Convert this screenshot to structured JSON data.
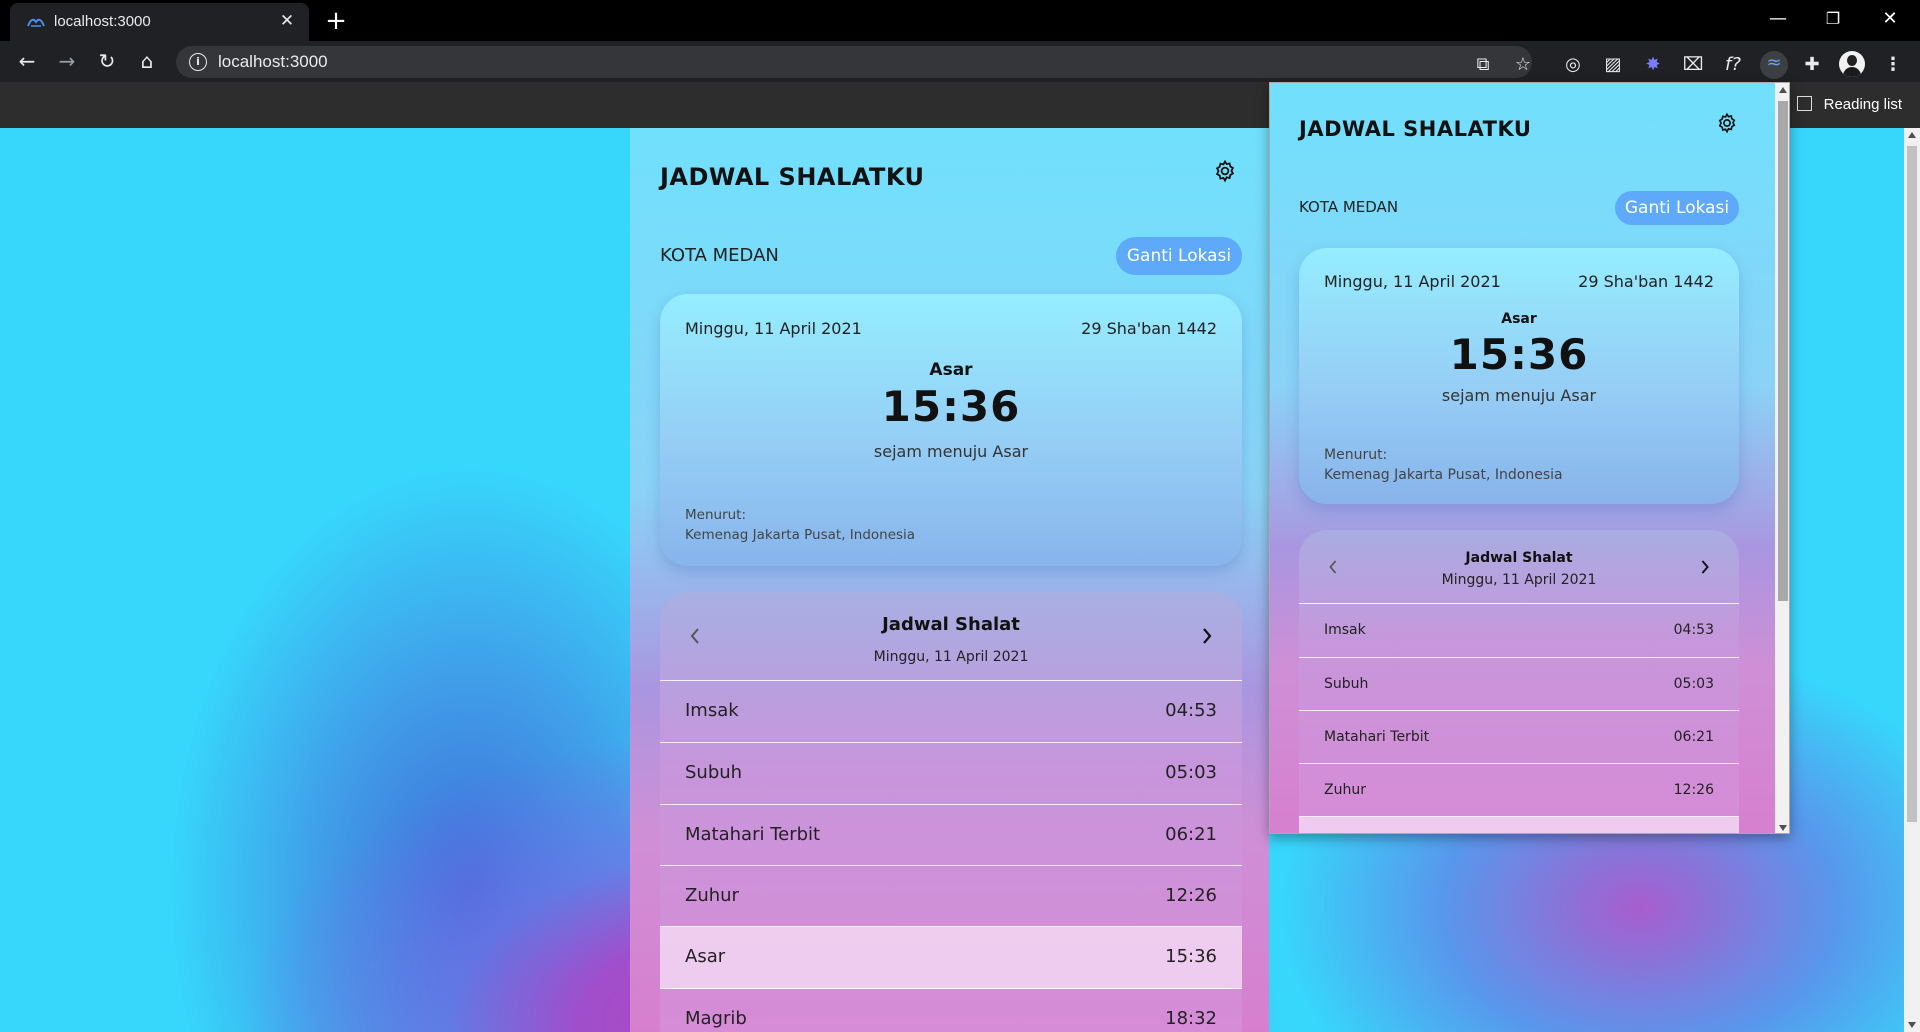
{
  "browser": {
    "tab_title": "localhost:3000",
    "tab_close": "✕",
    "new_tab": "+",
    "url": "localhost:3000",
    "reading_list": "Reading list",
    "win_minimize": "—",
    "win_restore": "❐",
    "win_close": "✕"
  },
  "app": {
    "title": "JADWAL SHALATKU",
    "city": "KOTA MEDAN",
    "change_location": "Ganti Lokasi",
    "card": {
      "gregorian_date": "Minggu, 11 April 2021",
      "hijri_date": "29 Sha'ban 1442",
      "next_prayer": "Asar",
      "clock": "15:36",
      "countdown": "sejam menuju Asar",
      "source_label": "Menurut:",
      "source": "Kemenag Jakarta Pusat, Indonesia"
    },
    "schedule": {
      "title": "Jadwal Shalat",
      "date": "Minggu, 11 April 2021",
      "rows": [
        {
          "name": "Imsak",
          "time": "04:53"
        },
        {
          "name": "Subuh",
          "time": "05:03"
        },
        {
          "name": "Matahari Terbit",
          "time": "06:21"
        },
        {
          "name": "Zuhur",
          "time": "12:26"
        },
        {
          "name": "Asar",
          "time": "15:36"
        },
        {
          "name": "Magrib",
          "time": "18:32"
        }
      ]
    }
  }
}
